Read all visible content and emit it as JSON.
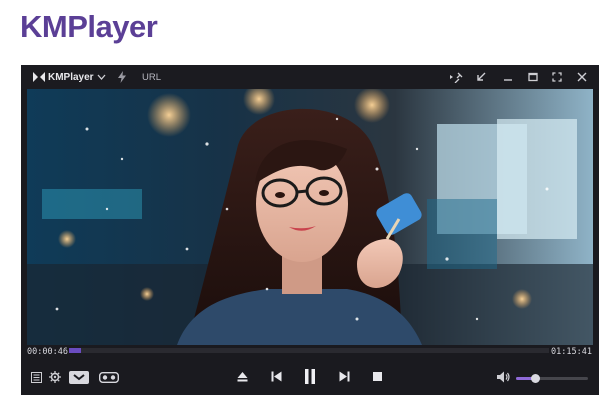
{
  "page": {
    "heading": "KMPlayer"
  },
  "player": {
    "app_name": "KMPlayer",
    "url_label": "URL",
    "elapsed_time": "00:00:46",
    "total_time": "01:15:41",
    "progress_fraction": 0.016,
    "volume_fraction": 0.27
  },
  "icons": {
    "titlebar_left": [
      "kmplayer-logo-icon",
      "chevron-down-icon",
      "lightning-icon"
    ],
    "titlebar_right": [
      "pin-icon",
      "mini-mode-icon",
      "minimize-icon",
      "maximize-icon",
      "fullscreen-icon",
      "close-icon"
    ],
    "controls_left": [
      "playlist-icon",
      "settings-gear-icon",
      "3d-icon",
      "vr-icon"
    ],
    "controls_center": [
      "eject-icon",
      "previous-icon",
      "pause-icon",
      "next-icon",
      "stop-icon"
    ],
    "controls_right": [
      "volume-icon"
    ]
  },
  "colors": {
    "heading": "#5b3f96",
    "player_bg": "#1a1a1f",
    "accent": "#6a4cc0"
  }
}
